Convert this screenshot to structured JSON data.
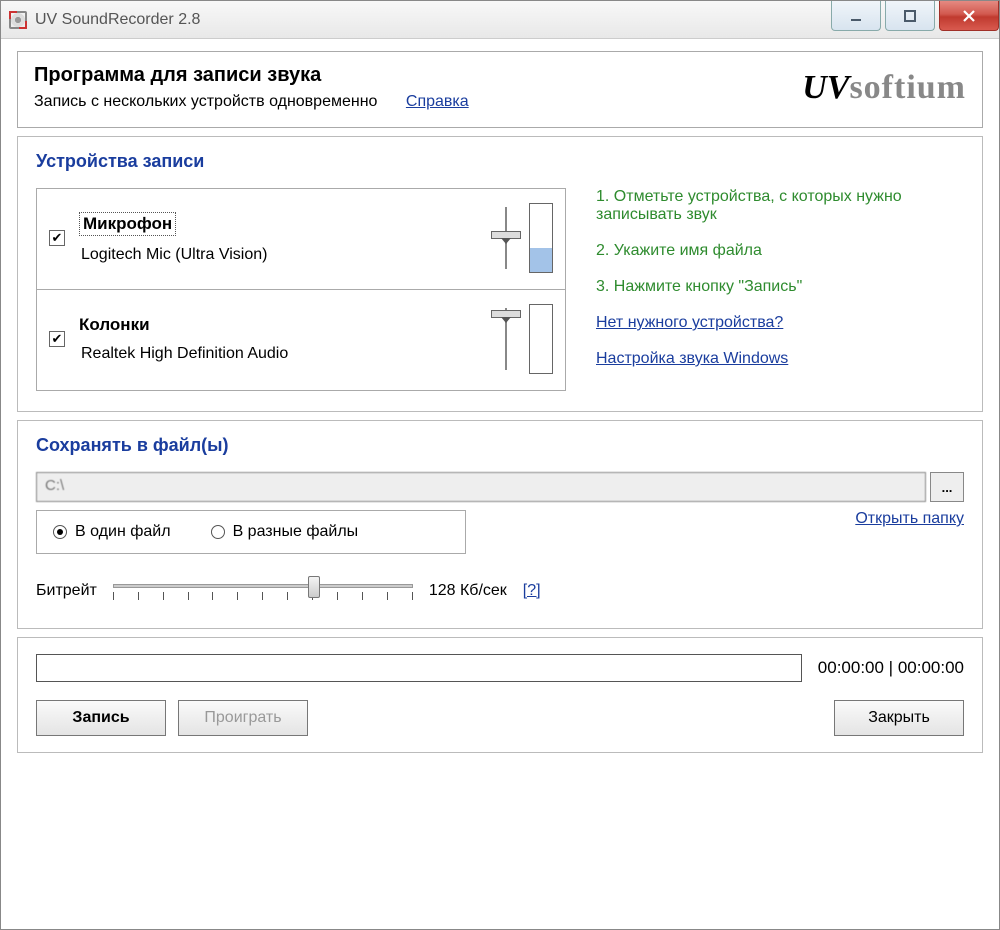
{
  "window": {
    "title": "UV SoundRecorder 2.8"
  },
  "header": {
    "title": "Программа для записи звука",
    "subtitle": "Запись с нескольких устройств одновременно",
    "help_link": "Справка",
    "brand_uv": "UV",
    "brand_soft": "softium"
  },
  "devices_section": {
    "title": "Устройства записи",
    "items": [
      {
        "checked": true,
        "name": "Микрофон",
        "desc": "Logitech Mic (Ultra Vision)",
        "selected": true,
        "thumb_pct": 40,
        "level_pct": 35
      },
      {
        "checked": true,
        "name": "Колонки",
        "desc": "Realtek High Definition Audio",
        "selected": false,
        "thumb_pct": 8,
        "level_pct": 0
      }
    ],
    "hints": [
      "1. Отметьте устройства, с которых нужно записывать звук",
      "2. Укажите имя файла",
      "3. Нажмите кнопку \"Запись\""
    ],
    "links": [
      "Нет нужного устройства?",
      "Настройка звука Windows"
    ]
  },
  "save_section": {
    "title": "Сохранять в файл(ы)",
    "path": "C:\\",
    "browse": "...",
    "open_folder_link": "Открыть папку",
    "radio_single": "В один файл",
    "radio_multi": "В разные файлы",
    "radio_selected": "single",
    "bitrate_label": "Битрейт",
    "bitrate_value": "128 Кб/сек",
    "bitrate_help": "[?]",
    "bitrate_slider_pct": 65
  },
  "bottom": {
    "time": "00:00:00 | 00:00:00",
    "record_btn": "Запись",
    "play_btn": "Проиграть",
    "close_btn": "Закрыть"
  }
}
